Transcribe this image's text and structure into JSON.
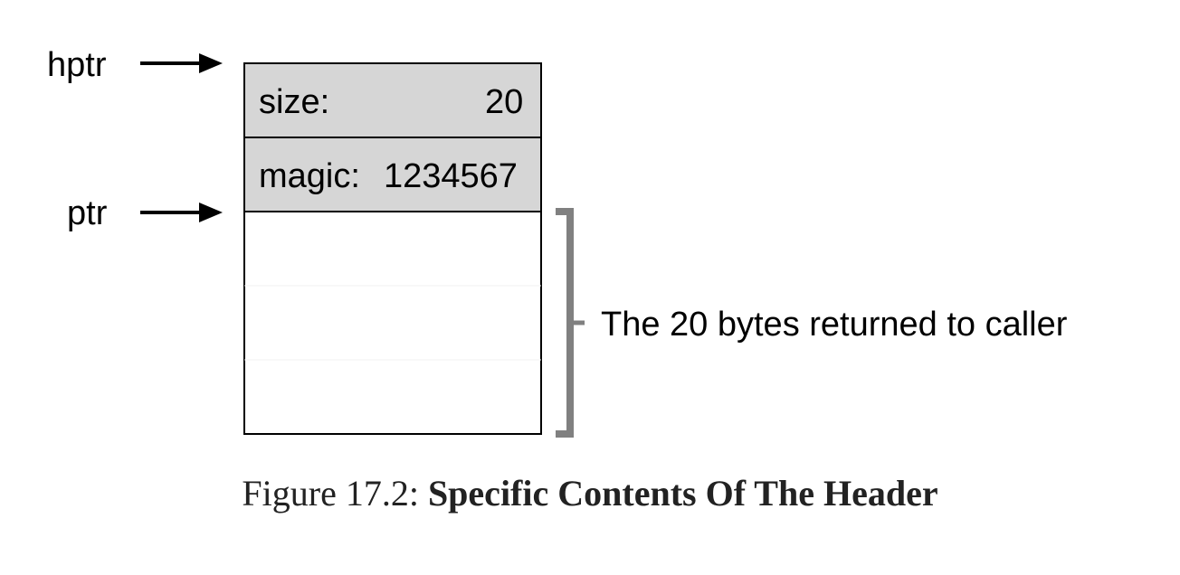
{
  "pointers": {
    "hptr": "hptr",
    "ptr": "ptr"
  },
  "header": {
    "size_label": "size:",
    "size_value": "20",
    "magic_label": "magic:",
    "magic_value": "1234567"
  },
  "bracket_label": "The 20 bytes returned to caller",
  "caption": {
    "prefix": "Figure 17.2:",
    "title": "Specific Contents Of The Header"
  },
  "colors": {
    "header_fill": "#d6d6d6",
    "bracket": "#808080",
    "line": "#000000"
  }
}
